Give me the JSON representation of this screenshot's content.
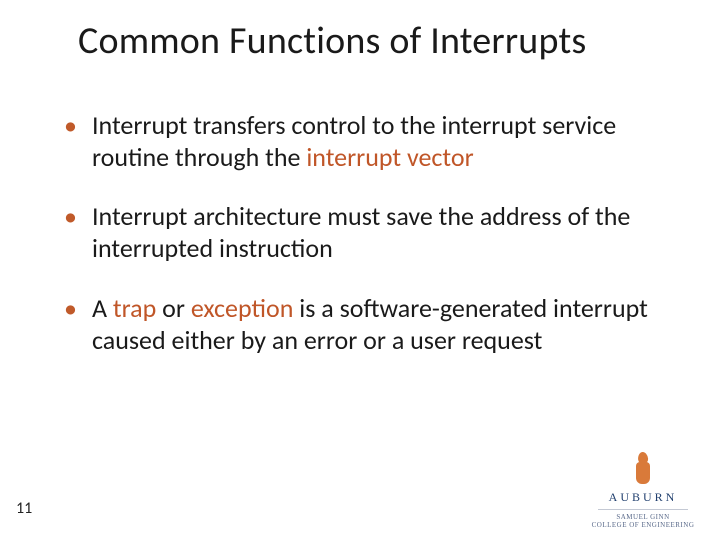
{
  "title": "Common Functions of Interrupts",
  "bullets": [
    {
      "pre": "Interrupt transfers control to the interrupt service routine through the ",
      "hl": "interrupt vector",
      "post": ""
    },
    {
      "pre": "Interrupt architecture must save the address of the interrupted instruction",
      "hl": "",
      "post": ""
    },
    {
      "pre": "A ",
      "hl": "trap",
      "mid": " or ",
      "hl2": "exception",
      "post": " is a software-generated interrupt caused either by an error or a user request"
    }
  ],
  "page_number": "11",
  "logo": {
    "name": "AUBURN",
    "sub1": "Samuel Ginn",
    "sub2": "College of Engineering"
  }
}
